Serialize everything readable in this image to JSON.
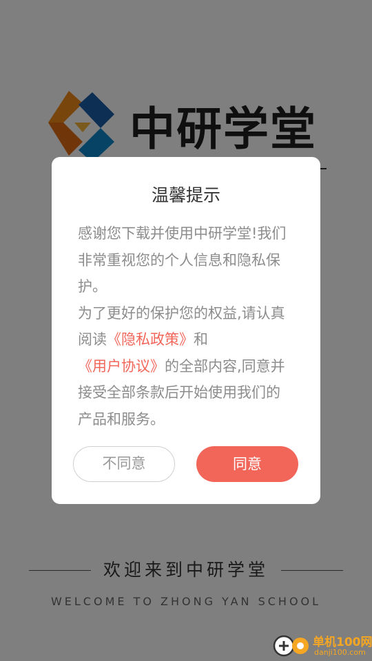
{
  "app": {
    "brand_name": "中研学堂",
    "welcome_cn": "欢迎来到中研学堂",
    "welcome_en": "WELCOME TO ZHONG YAN SCHOOL"
  },
  "dialog": {
    "title": "温馨提示",
    "body_p1": "感谢您下载并使用中研学堂!我们非常重视您的个人信息和隐私保护。",
    "body_p2_before": "为了更好的保护您的权益,请认真阅读",
    "privacy_link": "《隐私政策》",
    "and_text": "和",
    "agreement_link": "《用户协议》",
    "body_p2_after": "的全部内容,同意并接受全部条款后开始使用我们的产品和服务。",
    "disagree_label": "不同意",
    "agree_label": "同意"
  },
  "watermark": {
    "cn": "单机100网",
    "url": "danji100.com"
  },
  "colors": {
    "accent": "#f2665a",
    "overlay": "rgba(0,0,0,0.5)",
    "watermark": "#f5a623"
  },
  "icons": [
    "zhongyan-logo-icon",
    "danji100-logo-icon"
  ]
}
